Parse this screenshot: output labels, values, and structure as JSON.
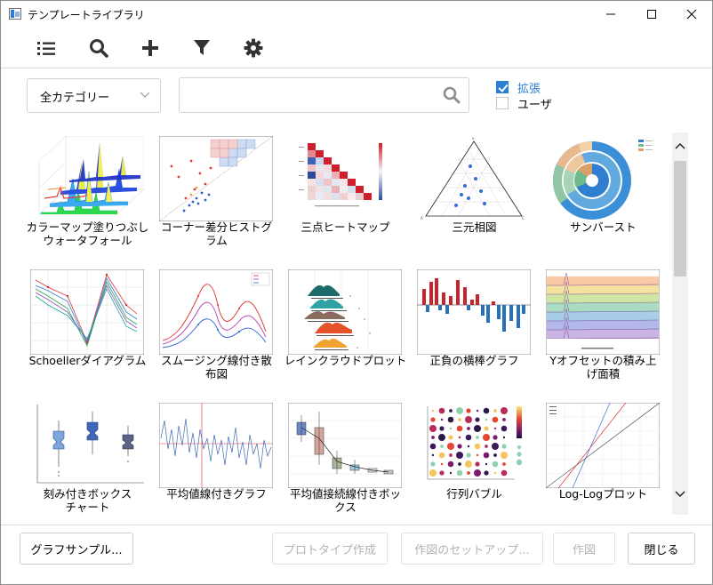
{
  "window": {
    "title": "テンプレートライブラリ"
  },
  "toolbar": {
    "items": [
      "list-icon",
      "search-icon",
      "add-icon",
      "filter-icon",
      "settings-icon"
    ]
  },
  "filter": {
    "category": "全カテゴリー",
    "search_value": "",
    "checkboxes": [
      {
        "label": "拡張",
        "checked": true
      },
      {
        "label": "ユーザ",
        "checked": false
      }
    ]
  },
  "templates": [
    {
      "label": "カラーマップ塗りつぶし\nウォータフォール",
      "type": "waterfall"
    },
    {
      "label": "コーナー差分ヒストグ\nラム",
      "type": "corner"
    },
    {
      "label": "三点ヒートマップ",
      "type": "heatmap"
    },
    {
      "label": "三元相図",
      "type": "ternary"
    },
    {
      "label": "サンバースト",
      "type": "sunburst"
    },
    {
      "label": "Schoellerダイアグラム",
      "type": "schoeller"
    },
    {
      "label": "スムージング線付き散\n布図",
      "type": "smooth"
    },
    {
      "label": "レインクラウドプロット",
      "type": "raincloud"
    },
    {
      "label": "正負の横棒グラフ",
      "type": "posneg"
    },
    {
      "label": "Yオフセットの積み上\nげ面積",
      "type": "yoffset"
    },
    {
      "label": "刻み付きボックス\nチャート",
      "type": "notchbox"
    },
    {
      "label": "平均値線付きグラフ",
      "type": "meanline"
    },
    {
      "label": "平均値接続線付きボッ\nクス",
      "type": "meanbox"
    },
    {
      "label": "行列バブル",
      "type": "bubble"
    },
    {
      "label": "Log-Logプロット",
      "type": "loglog"
    }
  ],
  "footer": {
    "sample": "グラフサンプル...",
    "prototype": "プロトタイプ作成",
    "setup": "作図のセットアップ...",
    "plot": "作図",
    "close": "閉じる"
  },
  "colors": {
    "accent": "#2d7fd3",
    "disabled_text": "#b3b3b3"
  }
}
